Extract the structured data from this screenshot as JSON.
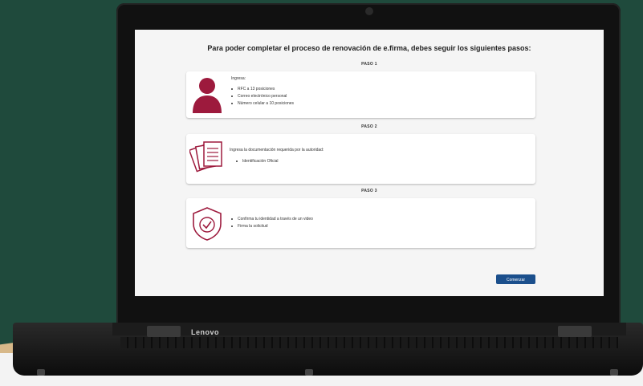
{
  "device": {
    "brand": "Lenovo"
  },
  "screen": {
    "title": "Para poder completar el proceso de renovación de e.firma, debes seguir los siguientes pasos:",
    "steps": [
      {
        "label": "PASO 1",
        "intro": "Ingresa:",
        "items": [
          "RFC a 13 posiciones",
          "Correo electrónico personal",
          "Número celular a 10 posiciones"
        ],
        "icon": "user-icon"
      },
      {
        "label": "PASO 2",
        "intro": "Ingresa la documentación requerida por la autoridad:",
        "items": [
          "Identificación Oficial"
        ],
        "icon": "documents-icon"
      },
      {
        "label": "PASO 3",
        "intro": "",
        "items": [
          "Confirma tu identidad a través de un video",
          "Firma la solicitud"
        ],
        "icon": "shield-check-icon"
      }
    ],
    "button_label": "Comenzar"
  },
  "colors": {
    "accent": "#9d1a3d",
    "button": "#1b4f8c",
    "background": "#1f4a3c"
  }
}
